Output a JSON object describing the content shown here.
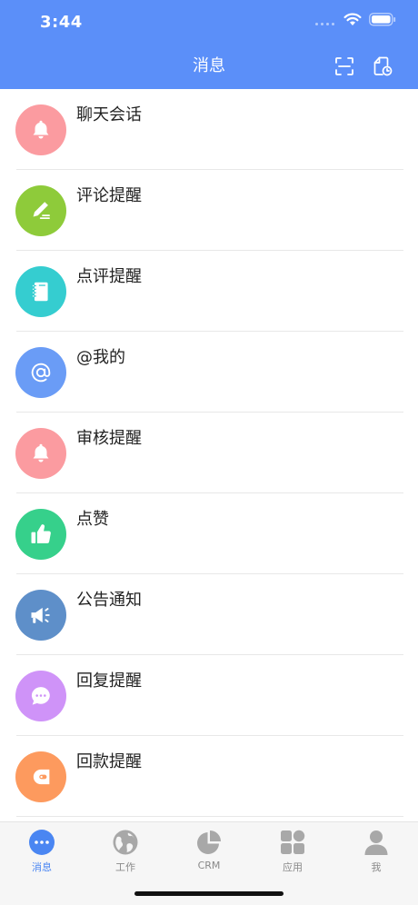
{
  "status_bar": {
    "time": "3:44",
    "icons": [
      "signal-dots-icon",
      "wifi-icon",
      "battery-icon"
    ]
  },
  "header": {
    "title": "消息",
    "background_color": "#5b8ff9",
    "actions": [
      "scan-icon",
      "history-icon"
    ]
  },
  "messages": [
    {
      "label": "聊天会话",
      "icon": "bell-icon",
      "color": "#fb9ba0"
    },
    {
      "label": "评论提醒",
      "icon": "pencil-icon",
      "color": "#8ecb3a"
    },
    {
      "label": "点评提醒",
      "icon": "notebook-icon",
      "color": "#35cdd0"
    },
    {
      "label": "@我的",
      "icon": "at-icon",
      "color": "#6a9cf6"
    },
    {
      "label": "审核提醒",
      "icon": "bell-icon",
      "color": "#fb9ba0"
    },
    {
      "label": "点赞",
      "icon": "thumbs-up-icon",
      "color": "#36d08b"
    },
    {
      "label": "公告通知",
      "icon": "megaphone-icon",
      "color": "#5e8fc9"
    },
    {
      "label": "回复提醒",
      "icon": "chat-bubble-icon",
      "color": "#cf93f8"
    },
    {
      "label": "回款提醒",
      "icon": "wallet-icon",
      "color": "#fd9a5e"
    }
  ],
  "tabbar": {
    "active_color": "#4a86f2",
    "tabs": [
      {
        "label": "消息",
        "icon": "message-dots-icon",
        "active": true
      },
      {
        "label": "工作",
        "icon": "globe-icon",
        "active": false
      },
      {
        "label": "CRM",
        "icon": "pie-chart-icon",
        "active": false
      },
      {
        "label": "应用",
        "icon": "apps-grid-icon",
        "active": false
      },
      {
        "label": "我",
        "icon": "person-icon",
        "active": false
      }
    ]
  }
}
